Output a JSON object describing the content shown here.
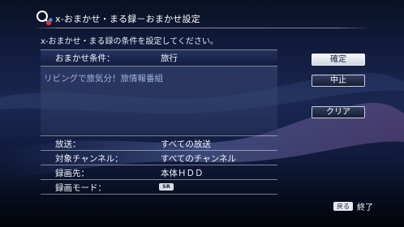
{
  "header": {
    "title": "x-おまかせ・まる録－おまかせ設定",
    "instruction": "x-おまかせ・まる録の条件を設定してください。"
  },
  "condition": {
    "label": "おまかせ条件：",
    "value": "旅行",
    "keyword": "リビングで旅気分！旅情報番組"
  },
  "settings": [
    {
      "label": "放送：",
      "value": "すべての放送"
    },
    {
      "label": "対象チャンネル：",
      "value": "すべてのチャンネル"
    },
    {
      "label": "録画先：",
      "value": "本体ＨＤＤ"
    },
    {
      "label": "録画モード：",
      "value": "SR"
    }
  ],
  "buttons": {
    "confirm": "確定",
    "cancel": "中止",
    "clear": "クリア"
  },
  "footer": {
    "back_key": "戻る",
    "back_label": "終了"
  },
  "colors": {
    "background": "#101a3a",
    "focused_button": "#f7f8fb",
    "keyword_text": "#9fb3df"
  }
}
